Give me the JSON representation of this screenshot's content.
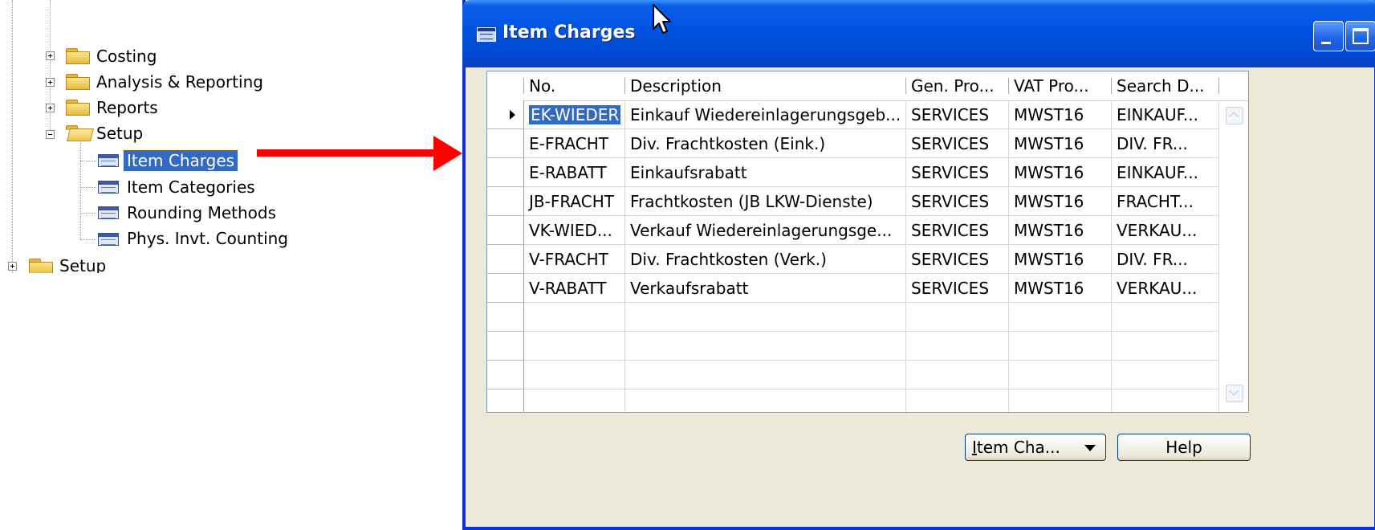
{
  "tree": {
    "items": [
      {
        "label": "Costing",
        "type": "folder",
        "expander": "plus"
      },
      {
        "label": "Analysis & Reporting",
        "type": "folder",
        "expander": "plus"
      },
      {
        "label": "Reports",
        "type": "folder",
        "expander": "plus"
      },
      {
        "label": "Setup",
        "type": "folder-open",
        "expander": "minus"
      },
      {
        "label": "Item Charges",
        "type": "form",
        "selected": true
      },
      {
        "label": "Item Categories",
        "type": "form"
      },
      {
        "label": "Rounding Methods",
        "type": "form"
      },
      {
        "label": "Phys. Invt. Counting",
        "type": "form"
      },
      {
        "label": "Setup",
        "type": "folder",
        "expander": "plus"
      }
    ]
  },
  "arrow_color": "#ff0000",
  "window": {
    "title": "Item Charges",
    "columns": [
      "No.",
      "Description",
      "Gen. Pro...",
      "VAT Pro...",
      "Search D..."
    ],
    "rows": [
      [
        "EK-WIEDER",
        "Einkauf Wiedereinlagerungsgeb...",
        "SERVICES",
        "MWST16",
        "EINKAUF..."
      ],
      [
        "E-FRACHT",
        "Div. Frachtkosten (Eink.)",
        "SERVICES",
        "MWST16",
        "DIV. FR..."
      ],
      [
        "E-RABATT",
        "Einkaufsrabatt",
        "SERVICES",
        "MWST16",
        "EINKAUF..."
      ],
      [
        "JB-FRACHT",
        "Frachtkosten (JB LKW-Dienste)",
        "SERVICES",
        "MWST16",
        "FRACHT..."
      ],
      [
        "VK-WIED...",
        "Verkauf Wiedereinlagerungsge...",
        "SERVICES",
        "MWST16",
        "VERKAU..."
      ],
      [
        "V-FRACHT",
        "Div. Frachtkosten (Verk.)",
        "SERVICES",
        "MWST16",
        "DIV. FR..."
      ],
      [
        "V-RABATT",
        "Verkaufsrabatt",
        "SERVICES",
        "MWST16",
        "VERKAU..."
      ],
      [
        "",
        "",
        "",
        "",
        ""
      ],
      [
        "",
        "",
        "",
        "",
        ""
      ],
      [
        "",
        "",
        "",
        "",
        ""
      ],
      [
        "",
        "",
        "",
        "",
        ""
      ]
    ],
    "item_button": {
      "underlined": "I",
      "rest": "tem Cha..."
    },
    "help_button": "Help"
  }
}
